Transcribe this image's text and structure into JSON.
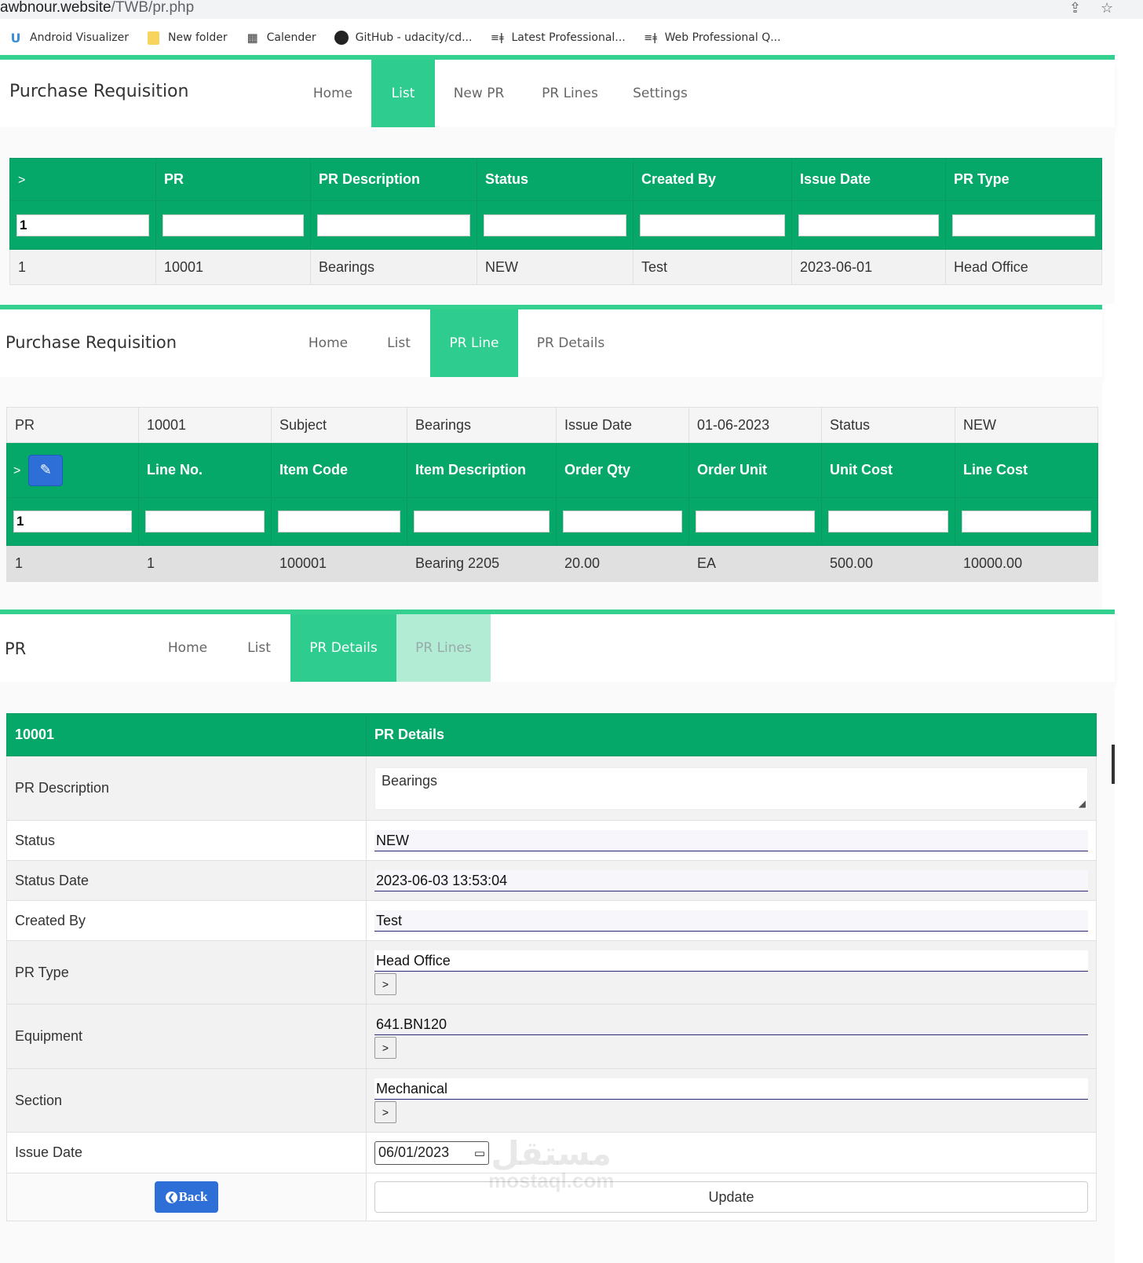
{
  "browser": {
    "url_host": "awbnour.website",
    "url_path": "/TWB/pr.php",
    "bookmarks": [
      {
        "label": "Android Visualizer",
        "icon": "android-visualizer-icon"
      },
      {
        "label": "New folder",
        "icon": "folder-icon"
      },
      {
        "label": "Calender",
        "icon": "calendar-icon"
      },
      {
        "label": "GitHub - udacity/cd...",
        "icon": "github-icon"
      },
      {
        "label": "Latest Professional...",
        "icon": "professional-icon"
      },
      {
        "label": "Web Professional Q...",
        "icon": "professional-icon"
      }
    ]
  },
  "colors": {
    "accent": "#2ecc8f",
    "header_green": "#06a86a",
    "button_blue": "#2d6fd6"
  },
  "list_view": {
    "brand": "Purchase Requisition",
    "nav": [
      "Home",
      "List",
      "New PR",
      "PR Lines",
      "Settings"
    ],
    "active": "List",
    "columns": [
      ">",
      "PR",
      "PR Description",
      "Status",
      "Created By",
      "Issue Date",
      "PR Type"
    ],
    "filter_first": "1",
    "row": [
      "1",
      "10001",
      "Bearings",
      "NEW",
      "Test",
      "2023-06-01",
      "Head Office"
    ]
  },
  "line_view": {
    "brand": "Purchase Requisition",
    "nav": [
      "Home",
      "List",
      "PR Line",
      "PR Details"
    ],
    "active": "PR Line",
    "info": [
      "PR",
      "10001",
      "Subject",
      "Bearings",
      "Issue Date",
      "01-06-2023",
      "Status",
      "NEW"
    ],
    "columns": [
      "Line No.",
      "Item Code",
      "Item Description",
      "Order Qty",
      "Order Unit",
      "Unit Cost",
      "Line Cost"
    ],
    "arrow": ">",
    "filter_first": "1",
    "row": [
      "1",
      "1",
      "100001",
      "Bearing 2205",
      "20.00",
      "EA",
      "500.00",
      "10000.00"
    ]
  },
  "details_view": {
    "brand": "PR",
    "nav": [
      "Home",
      "List",
      "PR Details",
      "PR Lines"
    ],
    "active": "PR Details",
    "header": {
      "pr_number": "10001",
      "title": "PR Details"
    },
    "fields": {
      "pr_description": {
        "label": "PR Description",
        "value": "Bearings"
      },
      "status": {
        "label": "Status",
        "value": "NEW"
      },
      "status_date": {
        "label": "Status Date",
        "value": "2023-06-03 13:53:04"
      },
      "created_by": {
        "label": "Created By",
        "value": "Test"
      },
      "pr_type": {
        "label": "PR Type",
        "value": "Head Office"
      },
      "equipment": {
        "label": "Equipment",
        "value": "641.BN120"
      },
      "section": {
        "label": "Section",
        "value": "Mechanical"
      },
      "issue_date": {
        "label": "Issue Date",
        "value": "06/01/2023"
      }
    },
    "lookup_label": ">",
    "back_label": "Back",
    "update_label": "Update"
  },
  "watermark": {
    "arabic": "مستقل",
    "latin": "mostaql.com"
  }
}
